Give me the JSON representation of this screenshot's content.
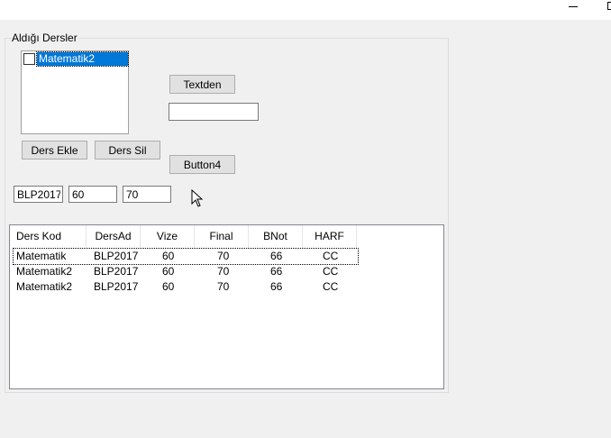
{
  "window": {
    "minimize_icon": "minimize-icon",
    "maximize_icon": "maximize-icon"
  },
  "group": {
    "title": "Aldığı Dersler"
  },
  "course_list": {
    "items": [
      {
        "label": "Matematik2",
        "checked": false
      }
    ]
  },
  "buttons": {
    "textden": "Textden",
    "ders_ekle": "Ders Ekle",
    "ders_sil": "Ders Sil",
    "button4": "Button4"
  },
  "inputs": {
    "text1": "",
    "code": "BLP2017",
    "vize": "60",
    "final": "70"
  },
  "grades_table": {
    "columns": [
      "Ders Kod",
      "DersAd",
      "Vize",
      "Final",
      "BNot",
      "HARF"
    ],
    "rows": [
      [
        "Matematik",
        "BLP2017",
        "60",
        "70",
        "66",
        "CC"
      ],
      [
        "Matematik2",
        "BLP2017",
        "60",
        "70",
        "66",
        "CC"
      ],
      [
        "Matematik2",
        "BLP2017",
        "60",
        "70",
        "66",
        "CC"
      ]
    ]
  }
}
